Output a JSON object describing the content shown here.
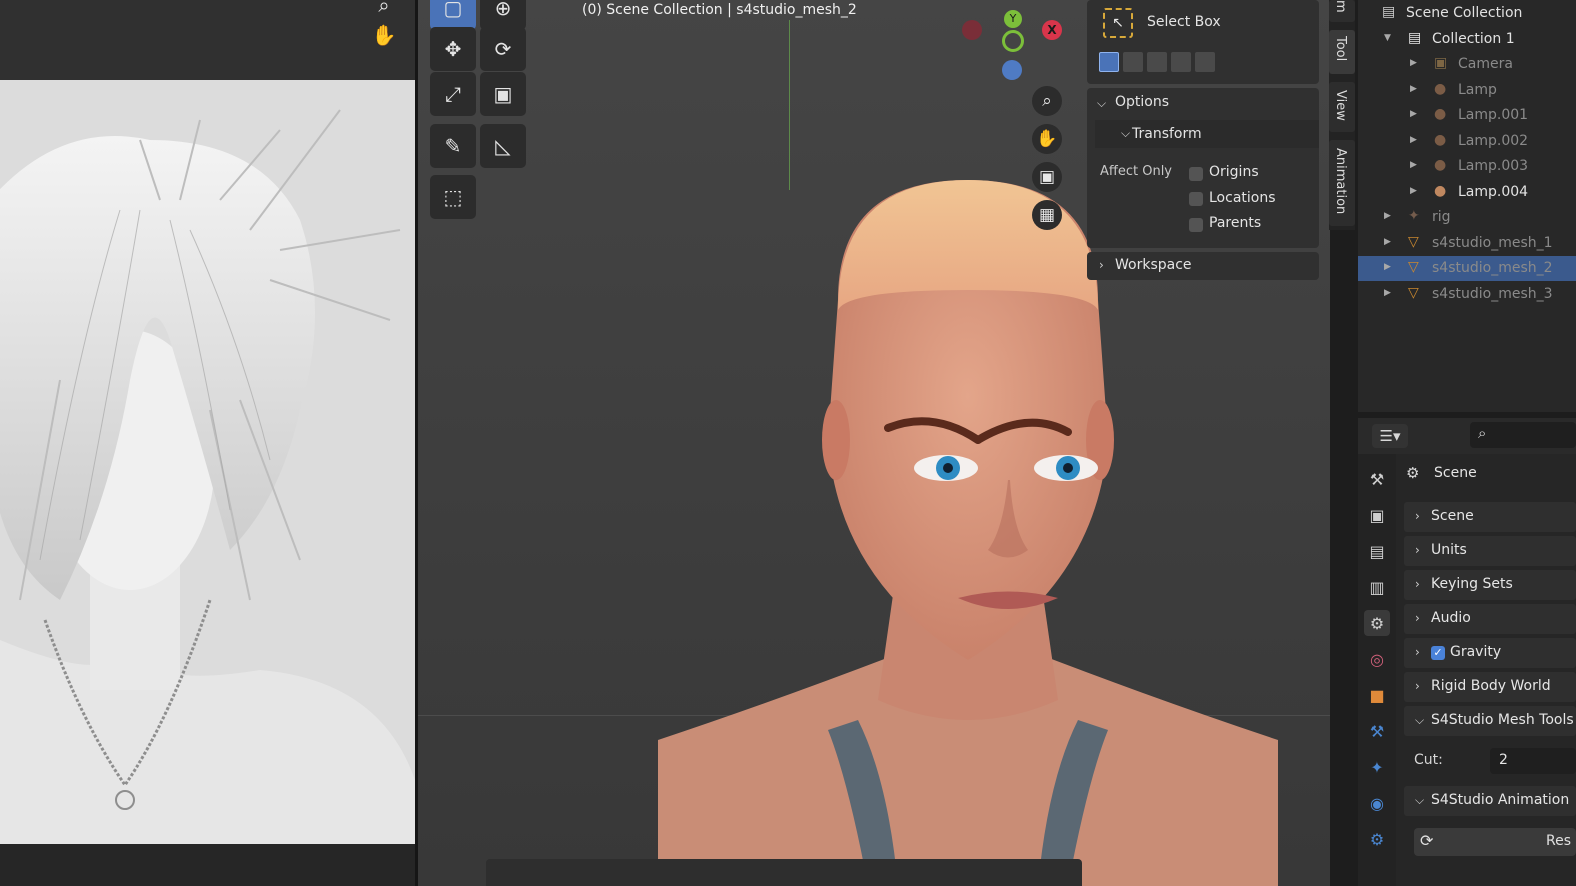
{
  "image_editor": {
    "icons": [
      "zoom-icon",
      "hand-icon"
    ]
  },
  "viewport": {
    "title": "(0) Scene Collection | s4studio_mesh_2",
    "axis_labels": {
      "x": "X",
      "y": "Y"
    },
    "tools": [
      "select-box-icon",
      "cursor-icon",
      "move-icon",
      "rotate-icon",
      "scale-icon",
      "transform-icon",
      "annotate-icon",
      "measure-icon",
      "add-cube-icon"
    ],
    "nav_icons": [
      "zoom-icon",
      "pan-icon",
      "camera-icon",
      "grid-icon"
    ]
  },
  "npanel": {
    "active_tool": "Select Box",
    "options_label": "Options",
    "transform_label": "Transform",
    "affect_only_label": "Affect Only",
    "affect_only": [
      {
        "label": "Origins",
        "checked": false
      },
      {
        "label": "Locations",
        "checked": false
      },
      {
        "label": "Parents",
        "checked": false
      }
    ],
    "workspace_label": "Workspace",
    "tabs": [
      "m",
      "Tool",
      "View",
      "Animation"
    ]
  },
  "outliner": {
    "rows": [
      {
        "label": "Scene Collection",
        "depth": 0,
        "icon": "scene-collection-icon",
        "muted": false,
        "selected": false
      },
      {
        "label": "Collection 1",
        "depth": 1,
        "icon": "collection-icon",
        "muted": false,
        "selected": false
      },
      {
        "label": "Camera",
        "depth": 2,
        "icon": "camera-icon",
        "muted": true,
        "selected": false
      },
      {
        "label": "Lamp",
        "depth": 2,
        "icon": "lamp-icon",
        "muted": true,
        "selected": false
      },
      {
        "label": "Lamp.001",
        "depth": 2,
        "icon": "lamp-icon",
        "muted": true,
        "selected": false
      },
      {
        "label": "Lamp.002",
        "depth": 2,
        "icon": "lamp-icon",
        "muted": true,
        "selected": false
      },
      {
        "label": "Lamp.003",
        "depth": 2,
        "icon": "lamp-icon",
        "muted": true,
        "selected": false
      },
      {
        "label": "Lamp.004",
        "depth": 2,
        "icon": "lamp-icon",
        "muted": false,
        "selected": false
      },
      {
        "label": "rig",
        "depth": 1,
        "icon": "armature-icon",
        "muted": true,
        "selected": false
      },
      {
        "label": "s4studio_mesh_1",
        "depth": 1,
        "icon": "mesh-icon",
        "muted": true,
        "selected": false
      },
      {
        "label": "s4studio_mesh_2",
        "depth": 1,
        "icon": "mesh-icon",
        "muted": true,
        "selected": true
      },
      {
        "label": "s4studio_mesh_3",
        "depth": 1,
        "icon": "mesh-icon",
        "muted": true,
        "selected": false
      }
    ]
  },
  "properties": {
    "breadcrumb": "Scene",
    "sections": [
      {
        "label": "Scene",
        "expanded": false
      },
      {
        "label": "Units",
        "expanded": false
      },
      {
        "label": "Keying Sets",
        "expanded": false
      },
      {
        "label": "Audio",
        "expanded": false
      },
      {
        "label": "Gravity",
        "expanded": false,
        "checkbox": true
      },
      {
        "label": "Rigid Body World",
        "expanded": false
      },
      {
        "label": "S4Studio Mesh Tools",
        "expanded": true
      },
      {
        "label": "S4Studio Animation",
        "expanded": true
      }
    ],
    "cut_label": "Cut:",
    "cut_value": "2",
    "reset_label": "Res",
    "side_tabs": [
      "tool-icon",
      "render-icon",
      "output-icon",
      "view-layer-icon",
      "scene-icon",
      "world-icon",
      "object-icon",
      "modifier-icon",
      "particles-icon",
      "physics-icon",
      "constraint-icon"
    ]
  },
  "colors": {
    "accent": "#4a73b8",
    "selected_row": "#3b5a8d",
    "x_axis": "#d9354b",
    "y_axis": "#7cbf3a",
    "z_axis": "#4f7bc4"
  }
}
